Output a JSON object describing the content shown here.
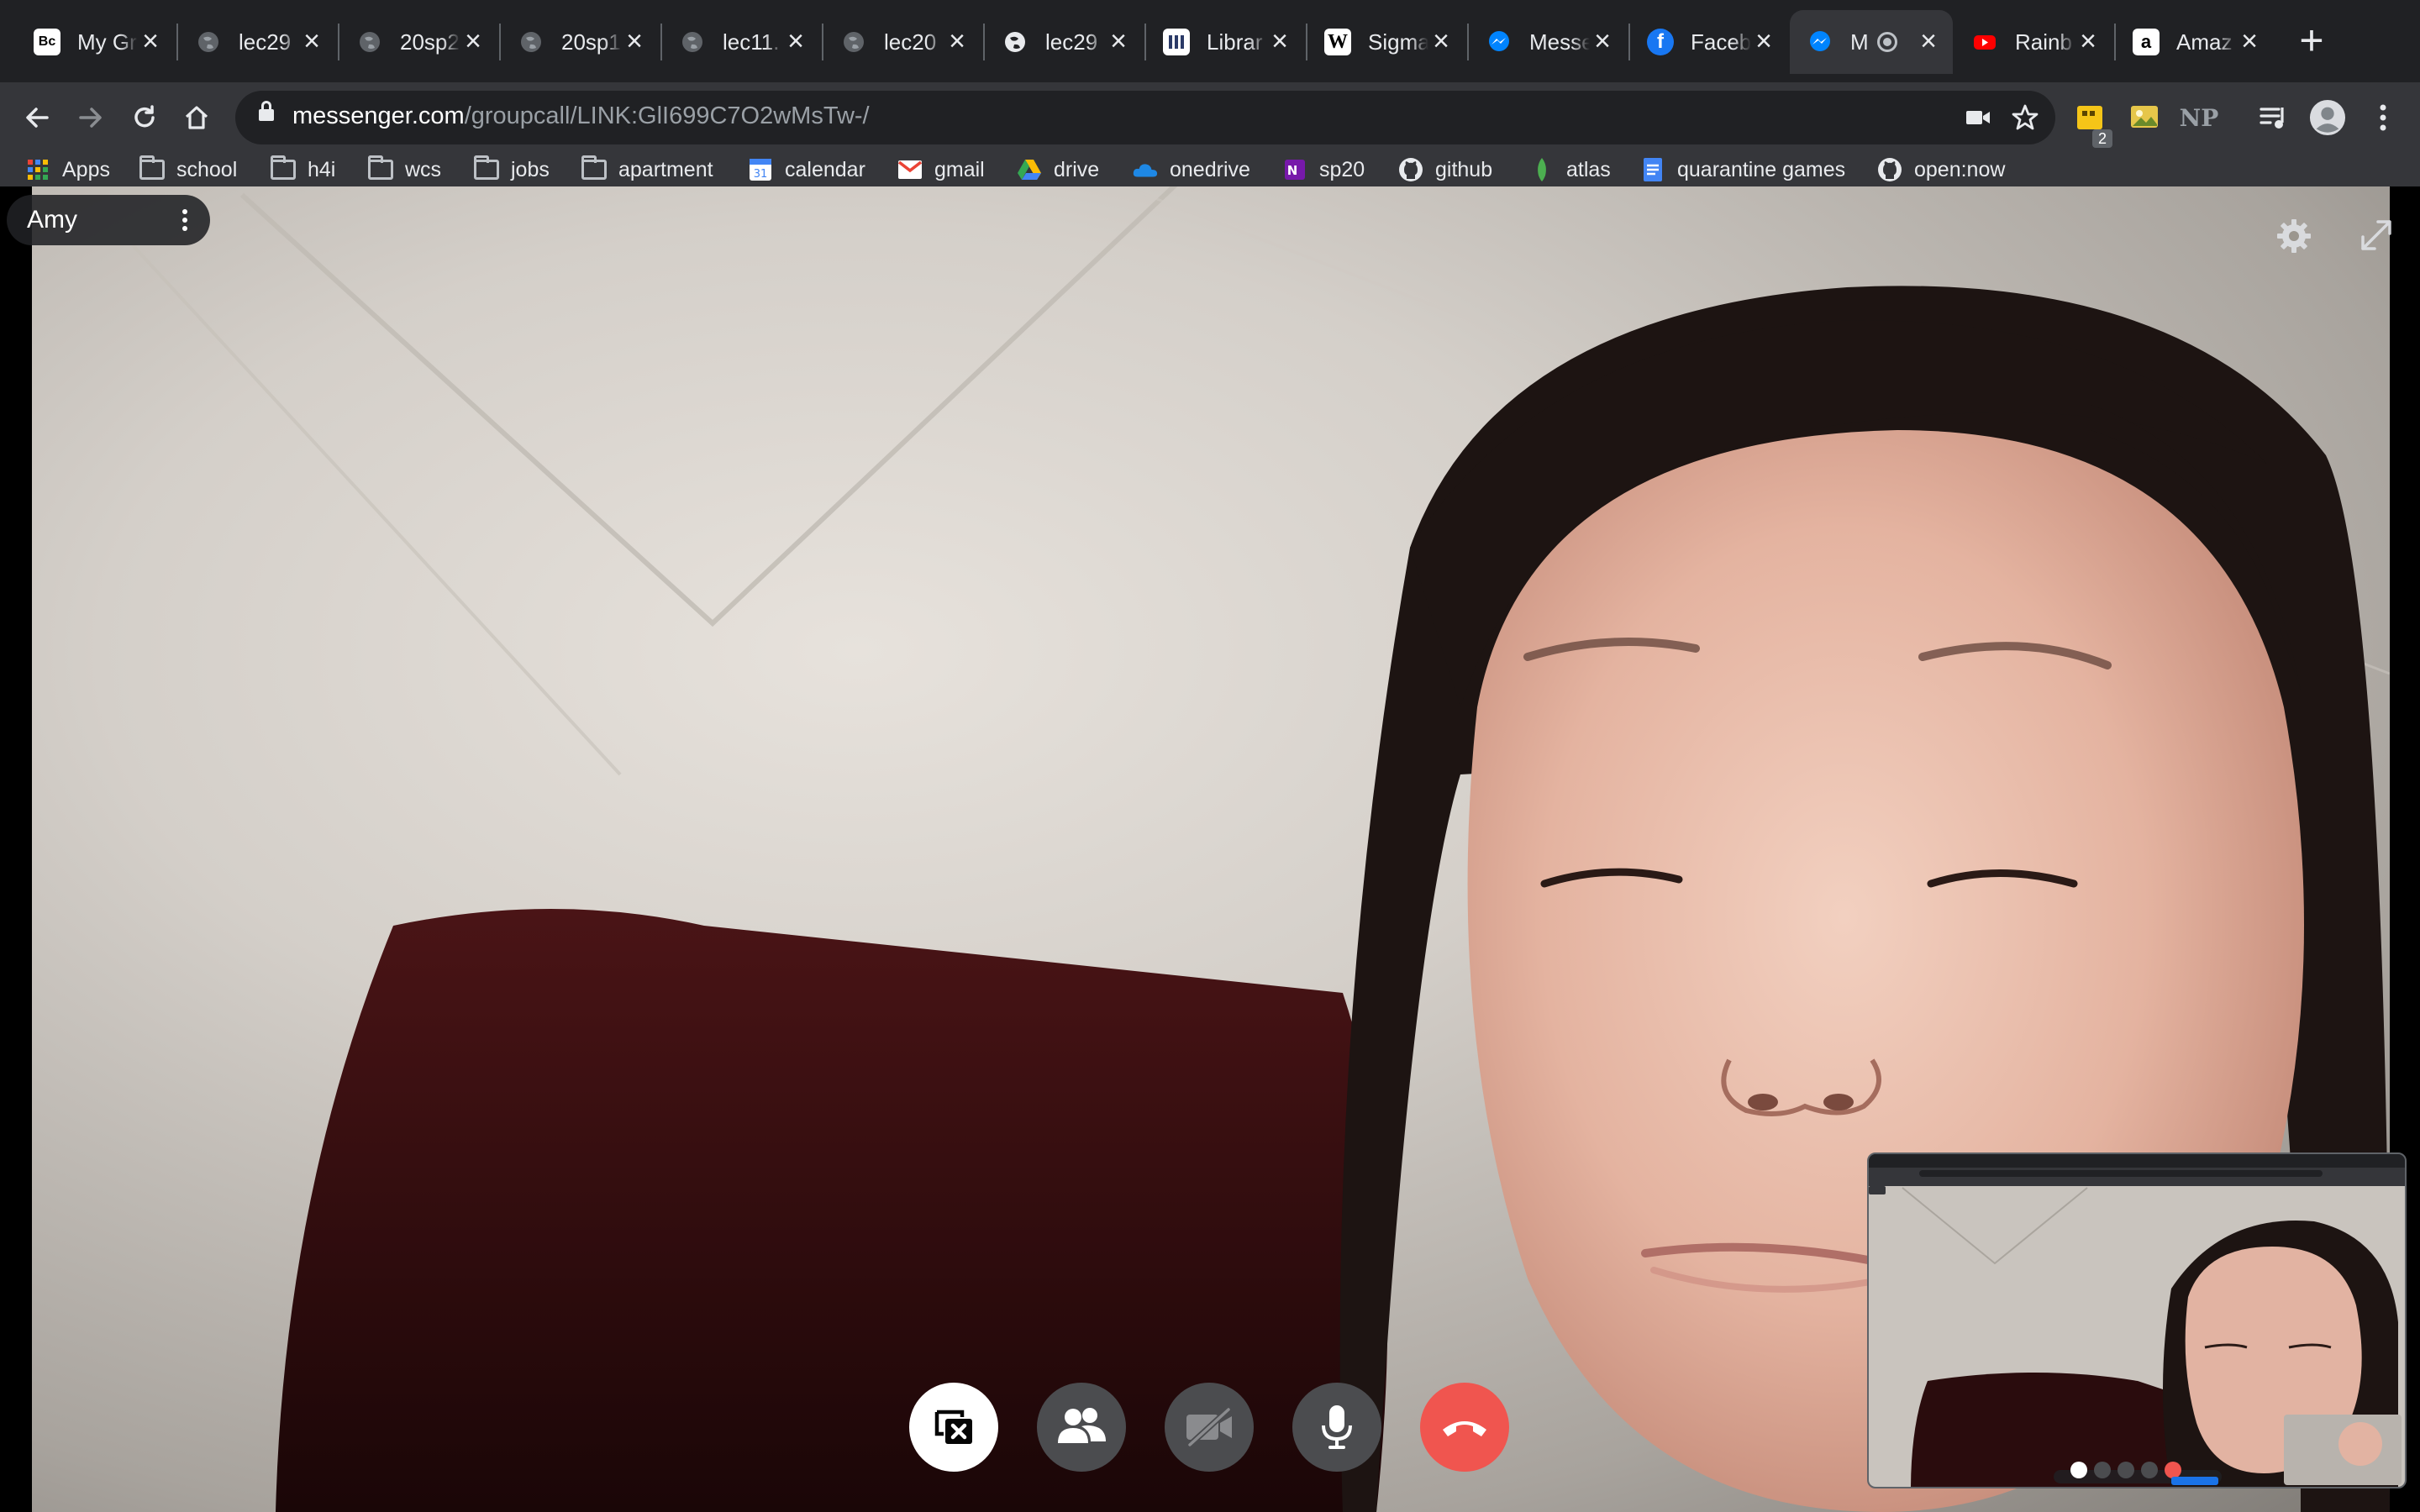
{
  "tabs": [
    {
      "title": "My Gr",
      "icon": "bandcamp-icon",
      "active": false
    },
    {
      "title": "lec29",
      "icon": "globe-icon",
      "active": false
    },
    {
      "title": "20sp2",
      "icon": "globe-icon",
      "active": false
    },
    {
      "title": "20sp1",
      "icon": "globe-icon",
      "active": false
    },
    {
      "title": "lec11.",
      "icon": "globe-icon",
      "active": false
    },
    {
      "title": "lec20",
      "icon": "globe-icon",
      "active": false
    },
    {
      "title": "lec29",
      "icon": "globe-icon",
      "active": false
    },
    {
      "title": "Librar",
      "icon": "library-icon",
      "active": false
    },
    {
      "title": "Sigma",
      "icon": "wikipedia-icon",
      "active": false
    },
    {
      "title": "Messe",
      "icon": "messenger-icon",
      "active": false
    },
    {
      "title": "Faceb",
      "icon": "facebook-icon",
      "active": false
    },
    {
      "title": "M",
      "icon": "messenger-icon",
      "active": true
    },
    {
      "title": "Rainb",
      "icon": "youtube-icon",
      "active": false
    },
    {
      "title": "Amaz",
      "icon": "amazon-icon",
      "active": false
    }
  ],
  "address_bar": {
    "host": "messenger.com",
    "path": "/groupcall/LINK:GlI699C7O2wMsTw-/"
  },
  "extensions": {
    "badge_count": "2",
    "np_label": "NP"
  },
  "bookmarks": [
    {
      "label": "Apps",
      "icon": "apps-grid-icon"
    },
    {
      "label": "school",
      "icon": "folder-icon"
    },
    {
      "label": "h4i",
      "icon": "folder-icon"
    },
    {
      "label": "wcs",
      "icon": "folder-icon"
    },
    {
      "label": "jobs",
      "icon": "folder-icon"
    },
    {
      "label": "apartment",
      "icon": "folder-icon"
    },
    {
      "label": "calendar",
      "icon": "calendar-icon"
    },
    {
      "label": "gmail",
      "icon": "gmail-icon"
    },
    {
      "label": "drive",
      "icon": "drive-icon"
    },
    {
      "label": "onedrive",
      "icon": "onedrive-icon"
    },
    {
      "label": "sp20",
      "icon": "onenote-icon"
    },
    {
      "label": "github",
      "icon": "github-icon"
    },
    {
      "label": "atlas",
      "icon": "atlas-icon"
    },
    {
      "label": "quarantine games",
      "icon": "docs-icon"
    },
    {
      "label": "open:now",
      "icon": "github-icon"
    }
  ],
  "call": {
    "participant_name": "Amy",
    "controls": [
      "screen-share-icon",
      "participants-icon",
      "camera-off-icon",
      "microphone-icon",
      "end-call-icon"
    ]
  },
  "colors": {
    "end_call": "#f0554f",
    "control_dark": "#4b4c4f",
    "messenger_blue": "#0084ff"
  }
}
